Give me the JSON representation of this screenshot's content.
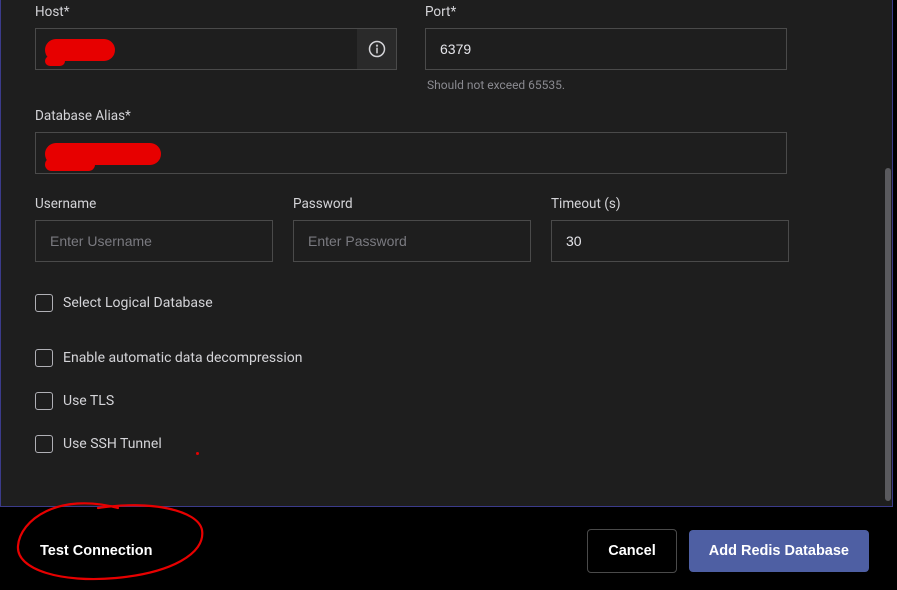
{
  "labels": {
    "host": "Host*",
    "port": "Port*",
    "port_helper": "Should not exceed 65535.",
    "alias": "Database Alias*",
    "username": "Username",
    "password": "Password",
    "timeout": "Timeout (s)"
  },
  "values": {
    "host": "",
    "port": "6379",
    "alias": "",
    "username": "",
    "password": "",
    "timeout": "30"
  },
  "placeholders": {
    "username": "Enter Username",
    "password": "Enter Password"
  },
  "options": {
    "select_db": "Select Logical Database",
    "decompress": "Enable automatic data decompression",
    "tls": "Use TLS",
    "ssh": "Use SSH Tunnel"
  },
  "buttons": {
    "test": "Test Connection",
    "cancel": "Cancel",
    "add": "Add Redis Database"
  }
}
